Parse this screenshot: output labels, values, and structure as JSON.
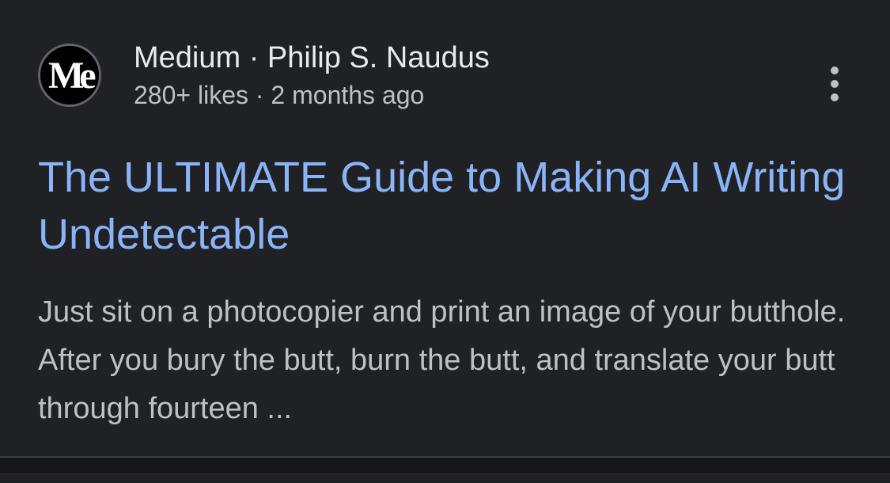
{
  "result": {
    "avatar": {
      "logo_text": "Me"
    },
    "source_line": "Medium · Philip S. Naudus",
    "stats_line": "280+ likes · 2 months ago",
    "more_icon": "more-vert-icon",
    "title": "The ULTIMATE Guide to Making AI Writing Undetectable",
    "snippet": "Just sit on a photocopier and print an image of your butthole. After you bury the butt, burn the butt, and translate your butt through fourteen ..."
  },
  "colors": {
    "background": "#202124",
    "title_link": "#8ab4f8",
    "primary_text": "#e8eaed",
    "secondary_text": "#bdc1c6"
  }
}
